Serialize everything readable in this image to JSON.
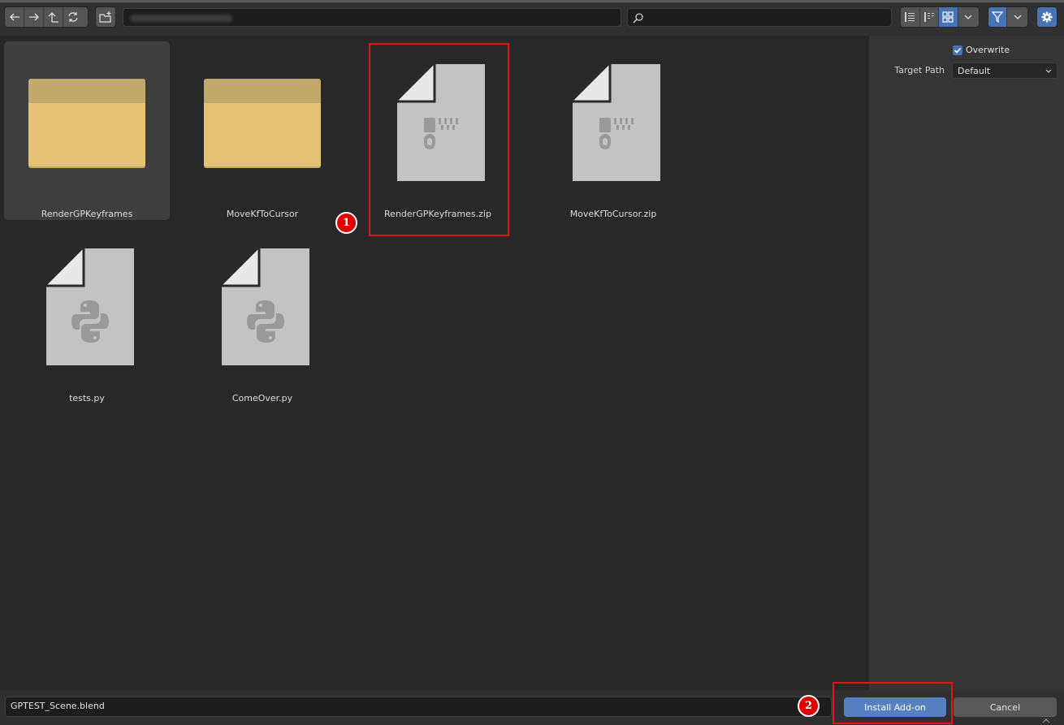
{
  "toolbar": {
    "nav_icons": [
      "back-arrow-icon",
      "forward-arrow-icon",
      "parent-directory-icon",
      "refresh-icon"
    ],
    "new_folder_icon": "new-folder-icon",
    "path_value": "",
    "search_placeholder": "",
    "display_modes": [
      "vertical-list",
      "horizontal-list",
      "thumbnails"
    ],
    "active_display_mode": "thumbnails"
  },
  "files": [
    {
      "name": "RenderGPKeyframes",
      "kind": "folder",
      "selected": true
    },
    {
      "name": "MoveKfToCursor",
      "kind": "folder",
      "selected": false
    },
    {
      "name": "RenderGPKeyframes.zip",
      "kind": "zip",
      "selected": false
    },
    {
      "name": "MoveKfToCursor.zip",
      "kind": "zip",
      "selected": false
    },
    {
      "name": "tests.py",
      "kind": "python",
      "selected": false
    },
    {
      "name": "ComeOver.py",
      "kind": "python",
      "selected": false
    }
  ],
  "side_panel": {
    "overwrite_label": "Overwrite",
    "overwrite_checked": true,
    "target_path_label": "Target Path",
    "target_path_value": "Default"
  },
  "bottom": {
    "filename": "GPTEST_Scene.blend",
    "install_label": "Install Add-on",
    "cancel_label": "Cancel"
  },
  "annotations": [
    "1",
    "2"
  ],
  "colors": {
    "accent": "#4772b3",
    "install_button": "#5680c2",
    "folder": "#e5c375",
    "highlight": "#e61515"
  }
}
